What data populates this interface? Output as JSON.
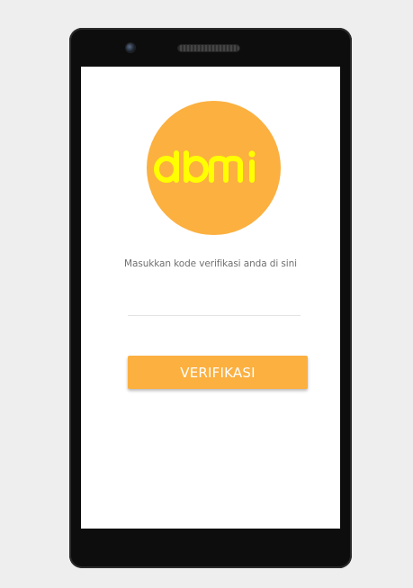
{
  "logo": {
    "text": "dbmi",
    "circle_color": "#fbb040",
    "text_color": "#ffff00"
  },
  "verification": {
    "prompt": "Masukkan kode verifikasi anda di sini",
    "code_value": "",
    "button_label": "VERIFIKASI",
    "accent_color": "#fbb040"
  },
  "device": {
    "icons": [
      "camera-icon",
      "speaker-grille-icon"
    ]
  }
}
